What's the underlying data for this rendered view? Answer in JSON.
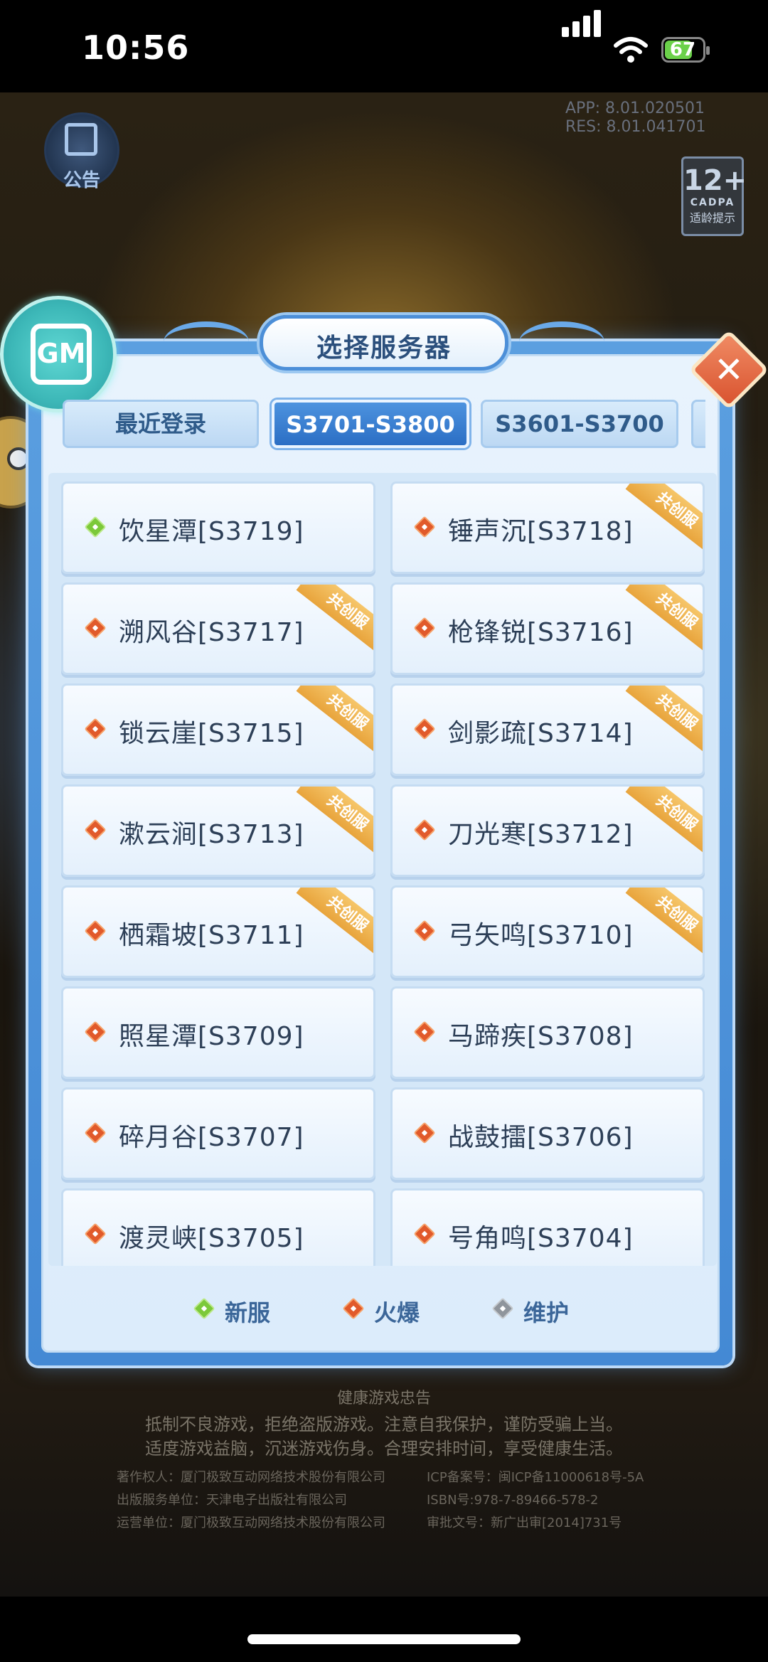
{
  "status_bar": {
    "time": "10:56",
    "battery": "67"
  },
  "game": {
    "version_app": "APP:   8.01.020501",
    "version_res": "RES:   8.01.041701",
    "notice_label": "公告",
    "age_rating": "12+",
    "age_org": "CADPA",
    "age_hint": "适龄提示"
  },
  "dialog": {
    "title": "选择服务器",
    "tabs": [
      {
        "label": "最近登录"
      },
      {
        "label": "S3701-S3800"
      },
      {
        "label": "S3601-S3700"
      }
    ],
    "servers": [
      {
        "name": "饮星潭[S3719]",
        "status": "new",
        "badge": ""
      },
      {
        "name": "锤声沉[S3718]",
        "status": "hot",
        "badge": "共创服"
      },
      {
        "name": "溯风谷[S3717]",
        "status": "hot",
        "badge": "共创服"
      },
      {
        "name": "枪锋锐[S3716]",
        "status": "hot",
        "badge": "共创服"
      },
      {
        "name": "锁云崖[S3715]",
        "status": "hot",
        "badge": "共创服"
      },
      {
        "name": "剑影疏[S3714]",
        "status": "hot",
        "badge": "共创服"
      },
      {
        "name": "漱云涧[S3713]",
        "status": "hot",
        "badge": "共创服"
      },
      {
        "name": "刀光寒[S3712]",
        "status": "hot",
        "badge": "共创服"
      },
      {
        "name": "栖霜坡[S3711]",
        "status": "hot",
        "badge": "共创服"
      },
      {
        "name": "弓矢鸣[S3710]",
        "status": "hot",
        "badge": "共创服"
      },
      {
        "name": "照星潭[S3709]",
        "status": "hot",
        "badge": ""
      },
      {
        "name": "马蹄疾[S3708]",
        "status": "hot",
        "badge": ""
      },
      {
        "name": "碎月谷[S3707]",
        "status": "hot",
        "badge": ""
      },
      {
        "name": "战鼓擂[S3706]",
        "status": "hot",
        "badge": ""
      },
      {
        "name": "渡灵峡[S3705]",
        "status": "hot",
        "badge": ""
      },
      {
        "name": "号角鸣[S3704]",
        "status": "hot",
        "badge": ""
      }
    ],
    "legend": {
      "new": "新服",
      "hot": "火爆",
      "maint": "维护"
    }
  },
  "footer": {
    "heading": "健康游戏忠告",
    "line1": "抵制不良游戏，拒绝盗版游戏。注意自我保护，谨防受骗上当。",
    "line2": "适度游戏益脑，沉迷游戏伤身。合理安排时间，享受健康生活。",
    "left1": "著作权人：厦门极致互动网络技术股份有限公司",
    "left2": "出版服务单位：天津电子出版社有限公司",
    "left3": "运营单位：厦门极致互动网络技术股份有限公司",
    "right1": "ICP备案号：闽ICP备11000618号-5A",
    "right2": "ISBN号:978-7-89466-578-2",
    "right3": "审批文号：新广出审[2014]731号"
  },
  "colors": {
    "hot": "#e15a2b",
    "new": "#7cc93a",
    "maint": "#8f959c",
    "accent": "#2b6ec4"
  }
}
